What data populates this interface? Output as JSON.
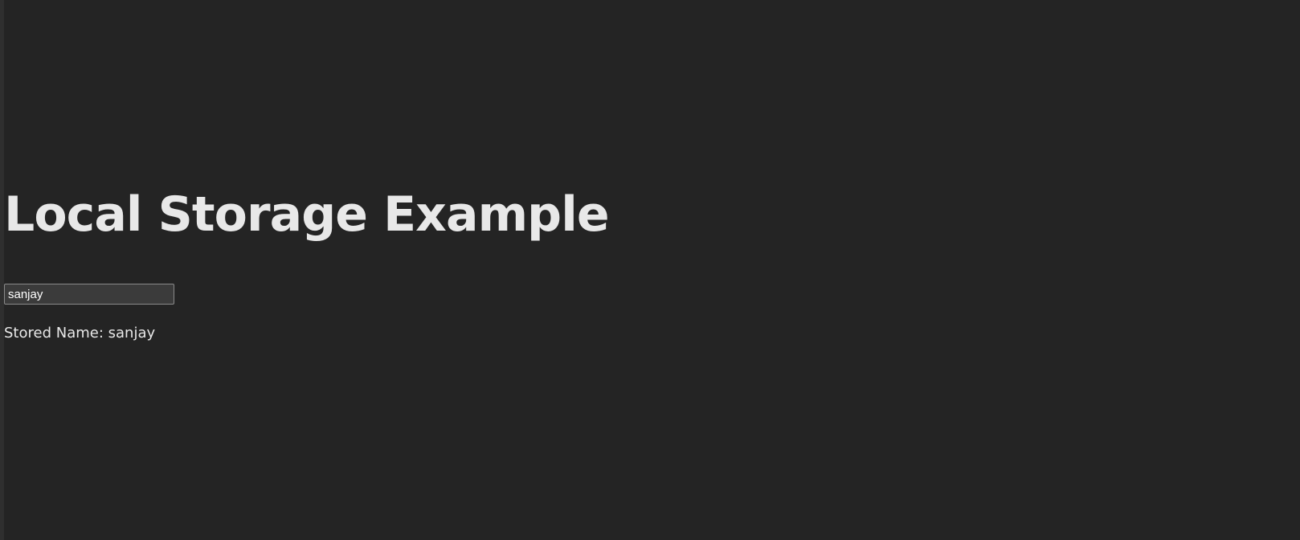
{
  "page": {
    "title": "Local Storage Example"
  },
  "name_field": {
    "value": "sanjay",
    "placeholder": ""
  },
  "stored": {
    "label": "Stored Name:",
    "value": "sanjay"
  },
  "colors": {
    "background": "#242424",
    "text": "#e8e8e8",
    "input_background": "#3b3b3b",
    "input_border": "#8a8a8a"
  }
}
